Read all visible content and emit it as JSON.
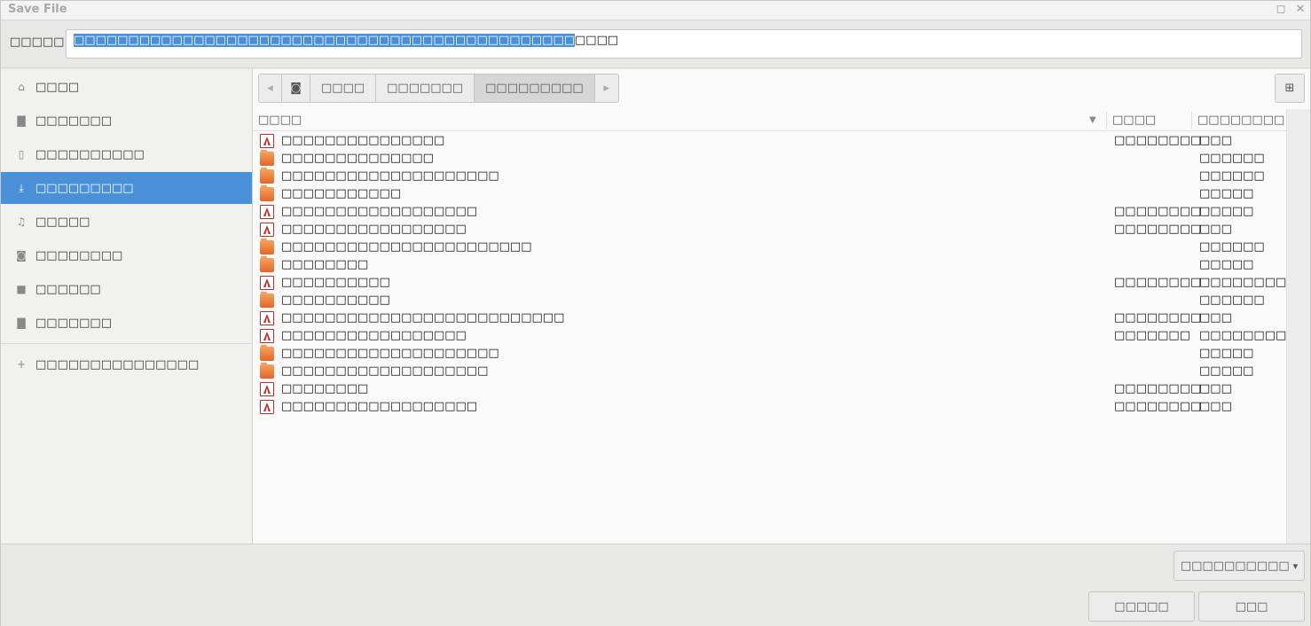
{
  "window": {
    "title": "Save File",
    "maximize_glyph": "◻",
    "close_glyph": "✕"
  },
  "namebar": {
    "label": "□□□□□",
    "selected_value": "□□□□□□□□□□□□□□□□□□□□□□□□□□□□□□□□□□□□□□□□□□□□□□",
    "unselected_value": "□□□□"
  },
  "sidebar": {
    "items": [
      {
        "icon": "home-icon",
        "glyph": "⌂",
        "label": "□□□□"
      },
      {
        "icon": "folder-icon",
        "glyph": "▇",
        "label": "□□□□□□□"
      },
      {
        "icon": "document-icon",
        "glyph": "▯",
        "label": "□□□□□□□□□□"
      },
      {
        "icon": "download-icon",
        "glyph": "⤓",
        "label": "□□□□□□□□□"
      },
      {
        "icon": "music-icon",
        "glyph": "♫",
        "label": "□□□□□"
      },
      {
        "icon": "camera-icon",
        "glyph": "◙",
        "label": "□□□□□□□□"
      },
      {
        "icon": "video-icon",
        "glyph": "■",
        "label": "□□□□□□"
      },
      {
        "icon": "folder-icon",
        "glyph": "▇",
        "label": "□□□□□□□"
      }
    ],
    "add_location": {
      "glyph": "+",
      "label": "□□□□□□□□□□□□□□□"
    }
  },
  "pathbar": {
    "back_glyph": "◂",
    "forward_glyph": "▸",
    "disk_glyph": "◙",
    "crumbs": [
      "□□□□",
      "□□□□□□□",
      "□□□□□□□□□"
    ]
  },
  "newfolder_glyph": "⊞",
  "columns": {
    "name": "□□□□",
    "size": "□□□□",
    "modified": "□□□□□□□□",
    "sort_glyph": "▼"
  },
  "files": [
    {
      "type": "pdf",
      "name": "□□□□□□□□□□□□□□□",
      "size": "□□□□□□□□",
      "modified": "□□□"
    },
    {
      "type": "folder",
      "name": "□□□□□□□□□□□□□□",
      "size": "",
      "modified": "□□□□□□"
    },
    {
      "type": "folder",
      "name": "□□□□□□□□□□□□□□□□□□□□",
      "size": "",
      "modified": "□□□□□□"
    },
    {
      "type": "folder",
      "name": "□□□□□□□□□□□",
      "size": "",
      "modified": "□□□□□"
    },
    {
      "type": "pdf",
      "name": "□□□□□□□□□□□□□□□□□□",
      "size": "□□□□□□□□",
      "modified": "□□□□□"
    },
    {
      "type": "pdf",
      "name": "□□□□□□□□□□□□□□□□□",
      "size": "□□□□□□□□",
      "modified": "□□□"
    },
    {
      "type": "folder",
      "name": "□□□□□□□□□□□□□□□□□□□□□□□",
      "size": "",
      "modified": "□□□□□□"
    },
    {
      "type": "folder",
      "name": "□□□□□□□□",
      "size": "",
      "modified": "□□□□□"
    },
    {
      "type": "pdf",
      "name": "□□□□□□□□□□",
      "size": "□□□□□□□□",
      "modified": "□□□□□□□□□□"
    },
    {
      "type": "folder",
      "name": "□□□□□□□□□□",
      "size": "",
      "modified": "□□□□□□"
    },
    {
      "type": "pdf",
      "name": "□□□□□□□□□□□□□□□□□□□□□□□□□□",
      "size": "□□□□□□□□",
      "modified": "□□□"
    },
    {
      "type": "pdf",
      "name": "□□□□□□□□□□□□□□□□□",
      "size": "□□□□□□□",
      "modified": "□□□□□□□□□□"
    },
    {
      "type": "folder",
      "name": "□□□□□□□□□□□□□□□□□□□□",
      "size": "",
      "modified": "□□□□□"
    },
    {
      "type": "folder",
      "name": "□□□□□□□□□□□□□□□□□□□",
      "size": "",
      "modified": "□□□□□"
    },
    {
      "type": "pdf",
      "name": "□□□□□□□□",
      "size": "□□□□□□□□",
      "modified": "□□□"
    },
    {
      "type": "pdf",
      "name": "□□□□□□□□□□□□□□□□□□",
      "size": "□□□□□□□□",
      "modified": "□□□"
    }
  ],
  "footer": {
    "filter_label": "□□□□□□□□□□",
    "filter_glyph": "▾",
    "cancel_label": "□□□□□",
    "save_label": "□□□"
  },
  "colors": {
    "accent": "#4a90d9",
    "folder": "#e5652a",
    "pdf": "#c12b2b"
  }
}
